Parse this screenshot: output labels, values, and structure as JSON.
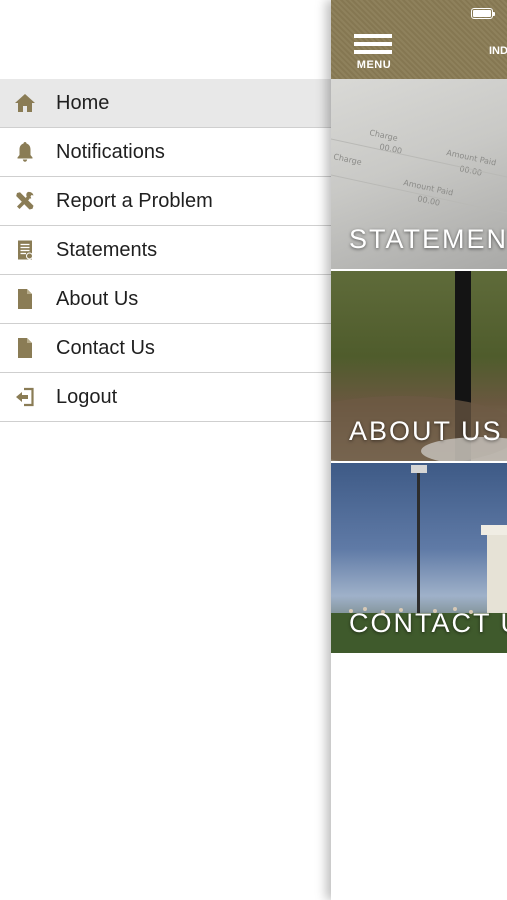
{
  "drawer": {
    "items": [
      {
        "label": "Home",
        "icon": "home-icon",
        "active": true
      },
      {
        "label": "Notifications",
        "icon": "bell-icon",
        "active": false
      },
      {
        "label": "Report a Problem",
        "icon": "tools-icon",
        "active": false
      },
      {
        "label": "Statements",
        "icon": "statement-icon",
        "active": false
      },
      {
        "label": "About Us",
        "icon": "document-icon",
        "active": false
      },
      {
        "label": "Contact Us",
        "icon": "document-icon",
        "active": false
      },
      {
        "label": "Logout",
        "icon": "logout-icon",
        "active": false
      }
    ]
  },
  "topbar": {
    "menu_caption": "MENU",
    "truncated_label": "IND"
  },
  "tiles": [
    {
      "label": "STATEMENTS"
    },
    {
      "label": "ABOUT US"
    },
    {
      "label": "CONTACT US"
    }
  ],
  "colors": {
    "accent": "#8a7c55",
    "active_row": "#e8e8e8",
    "divider": "#cfcfcf"
  }
}
